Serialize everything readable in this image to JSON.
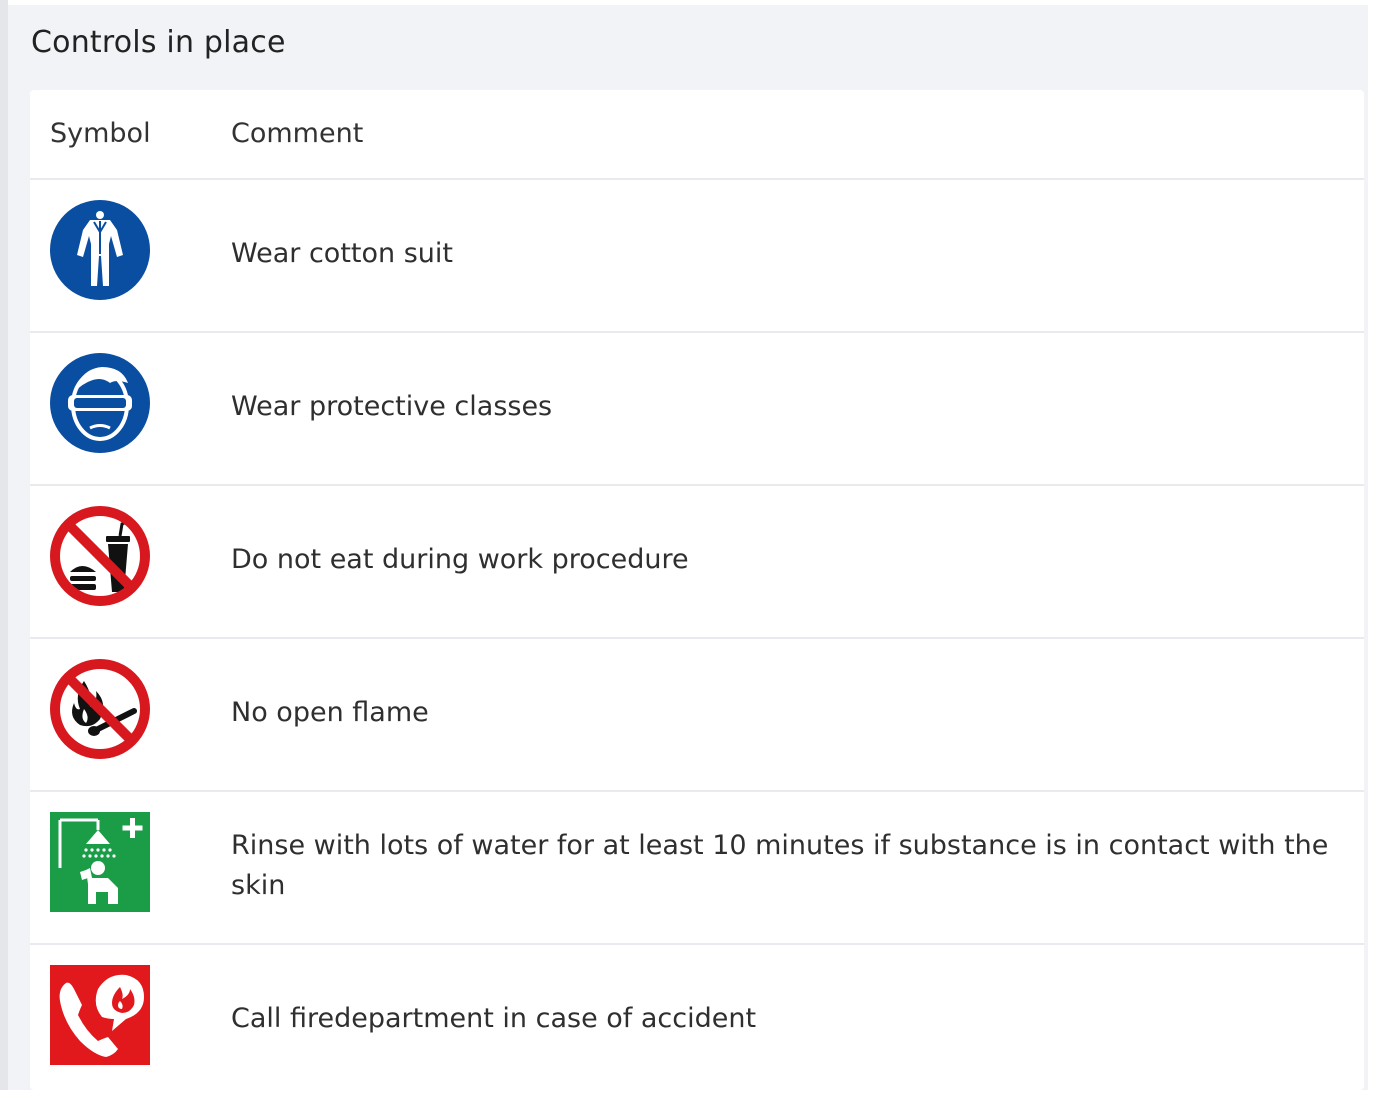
{
  "panel": {
    "title": "Controls in place"
  },
  "table": {
    "headers": {
      "symbol": "Symbol",
      "comment": "Comment"
    },
    "rows": [
      {
        "icon": "coverall-mandatory-icon",
        "comment": "Wear cotton suit"
      },
      {
        "icon": "goggles-mandatory-icon",
        "comment": "Wear protective classes"
      },
      {
        "icon": "no-eating-drinking-icon",
        "comment": "Do not eat during work procedure"
      },
      {
        "icon": "no-open-flame-icon",
        "comment": "No open flame"
      },
      {
        "icon": "safety-shower-icon",
        "comment": "Rinse with lots of water for at least 10 minutes if substance is in contact with the skin"
      },
      {
        "icon": "fire-emergency-phone-icon",
        "comment": "Call firedepartment in case of accident"
      }
    ]
  },
  "colors": {
    "mandatory_blue": "#0a4ea2",
    "prohibition_red": "#d7191f",
    "safe_green": "#1b9d48",
    "fire_red": "#e2191c",
    "panel_bg": "#f1f3f6"
  }
}
